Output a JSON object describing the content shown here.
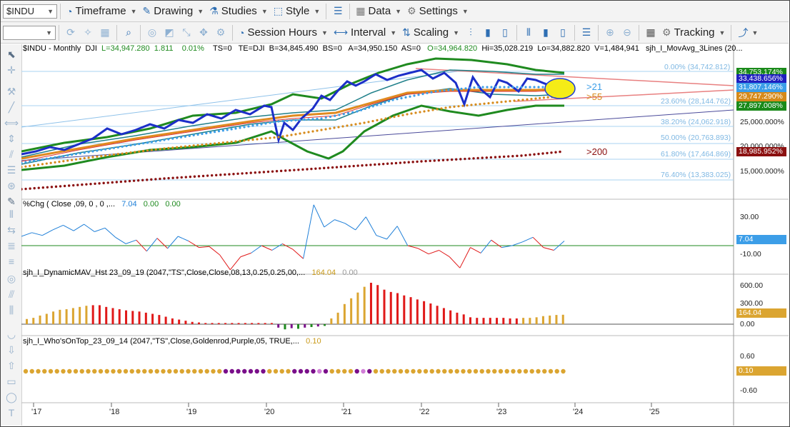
{
  "toolbar": {
    "symbol": "$INDU",
    "timeframe": "Timeframe",
    "drawing": "Drawing",
    "studies": "Studies",
    "style": "Style",
    "data": "Data",
    "settings": "Settings",
    "session_hours": "Session Hours",
    "interval": "Interval",
    "scaling": "Scaling",
    "tracking": "Tracking"
  },
  "price_header": {
    "symbol": "$INDU - Monthly",
    "exchange": "DJI",
    "last": "L=34,947.280",
    "net": "1.811",
    "pct": "0.01%",
    "ts": "TS=0",
    "te": "TE=DJI",
    "bid": "B=34,845.490",
    "bs": "BS=0",
    "ask": "A=34,950.150",
    "as": "AS=0",
    "open": "O=34,964.820",
    "high": "Hi=35,028.219",
    "low": "Lo=34,882.820",
    "volume": "V=1,484,941",
    "study": "sjh_I_MovAvg_3Lines (20..."
  },
  "price_scale": [
    "25,000.000%",
    "20,000.000%",
    "15,000.000%"
  ],
  "price_badges": [
    {
      "text": "34,753.174%",
      "color": "#1a8a1a"
    },
    {
      "text": "33,438.656%",
      "color": "#1f1fbf"
    },
    {
      "text": "31,807.146%",
      "color": "#3c9ee8"
    },
    {
      "text": "29,747.290%",
      "color": "#d68a1a"
    },
    {
      "text": "27,897.008%",
      "color": "#1a8a1a"
    },
    {
      "text": "18,985.952%",
      "color": "#8b1010"
    }
  ],
  "fib_levels": [
    "0.00% (34,742.812)",
    "23.60% (28,144.762)",
    "38.20% (24,062.918)",
    "50.00% (20,763.893)",
    "61.80% (17,464.869)",
    "76.40% (13,383.025)"
  ],
  "annotations": {
    "ma21": ">21",
    "ma55": ">55",
    "ma200": ">200"
  },
  "pctchg": {
    "header": "%Chg ( Close ,09, 0 , 0 ,...",
    "v1": "7.04",
    "v2": "0.00",
    "v3": "0.00",
    "scale": [
      "30.00",
      "7.04",
      "-10.00"
    ],
    "badge": "7.04"
  },
  "dynmav": {
    "header": "sjh_I_DynamicMAV_Hst 23_09_19 (2047,\"TS\",Close,Close,08,13,0.25,0.25,00,...",
    "v1": "164.04",
    "v2": "0.00",
    "scale": [
      "600.00",
      "300.00",
      "0.00"
    ],
    "badge": "164.04"
  },
  "whoson": {
    "header": "sjh_I_Who'sOnTop_23_09_14 (2047,\"TS\",Close,Goldenrod,Purple,05,  TRUE,...",
    "v1": "0.10",
    "scale": [
      "0.60",
      "-0.60"
    ],
    "badge": "0.10"
  },
  "x_axis": [
    "'17",
    "'18",
    "'19",
    "'20",
    "'21",
    "'22",
    "'23",
    "'24",
    "'25"
  ],
  "colors": {
    "up": "#1e7fd8",
    "down": "#e01919",
    "gold": "#dba531",
    "purple": "#7a0f8a",
    "green": "#1f8a1f"
  },
  "chart_data": {
    "type": "line",
    "title": "$INDU - Monthly",
    "series": [
      {
        "name": "%Chg",
        "values": [
          10,
          14,
          11,
          17,
          22,
          16,
          23,
          15,
          19,
          9,
          2,
          6,
          -6,
          8,
          -3,
          10,
          5,
          -2,
          -1,
          -10,
          -26,
          -12,
          -8,
          0,
          -5,
          2,
          -4,
          -14,
          44,
          20,
          28,
          24,
          17,
          31,
          11,
          7,
          21,
          0,
          -3,
          -9,
          -5,
          -12,
          -24,
          -2,
          -8,
          6,
          -2,
          0,
          4,
          9,
          -2,
          -5,
          5
        ]
      },
      {
        "name": "sjh_I_DynamicMAV_Hst",
        "values": [
          90,
          110,
          150,
          180,
          220,
          250,
          260,
          280,
          300,
          320,
          330,
          330,
          300,
          280,
          260,
          240,
          230,
          220,
          200,
          180,
          160,
          130,
          100,
          80,
          60,
          40,
          30,
          20,
          20,
          20,
          20,
          20,
          20,
          20,
          20,
          20,
          20,
          20,
          -60,
          -90,
          -70,
          -80,
          -60,
          -50,
          -40,
          -30,
          100,
          200,
          350,
          450,
          550,
          650,
          720,
          680,
          600,
          560,
          540,
          500,
          470,
          430,
          400,
          360,
          320,
          280,
          240,
          200,
          170,
          120,
          110,
          110,
          110,
          110,
          110,
          100,
          100,
          110,
          110,
          120,
          140,
          150,
          160,
          164
        ]
      },
      {
        "name": "sjh_I_Who'sOnTop",
        "values": [
          0.1
        ]
      }
    ],
    "ylim": [
      -0.6,
      0.6
    ]
  }
}
